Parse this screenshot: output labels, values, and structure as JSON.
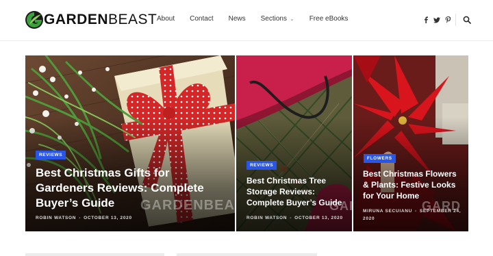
{
  "site": {
    "logo_bold": "GARDEN",
    "logo_light": "BEAST"
  },
  "nav": {
    "items": [
      "About",
      "Contact",
      "News",
      "Sections",
      "Free eBooks"
    ]
  },
  "social": {
    "icons": [
      "facebook-icon",
      "twitter-icon",
      "pinterest-icon"
    ],
    "search_icon": "search-icon"
  },
  "colors": {
    "accent": "#2956e6",
    "logo_green": "#3aa23a"
  },
  "cards": [
    {
      "category": "REVIEWS",
      "title": "Best Christmas Gifts for Gardeners Reviews: Complete Buyer’s Guide",
      "author": "ROBIN WATSON",
      "date": "OCTOBER 13, 2020",
      "watermark": "GARDENBEAST"
    },
    {
      "category": "REVIEWS",
      "title": "Best Christmas Tree Storage Reviews: Complete Buyer’s Guide",
      "author": "ROBIN WATSON",
      "date": "OCTOBER 13, 2020",
      "watermark": "GARD"
    },
    {
      "category": "FLOWERS",
      "title": "Best Christmas Flowers & Plants: Festive Looks for Your Home",
      "author": "MIRUNA SECUIANU",
      "date": "SEPTEMBER 24, 2020",
      "watermark": "GARD"
    }
  ]
}
